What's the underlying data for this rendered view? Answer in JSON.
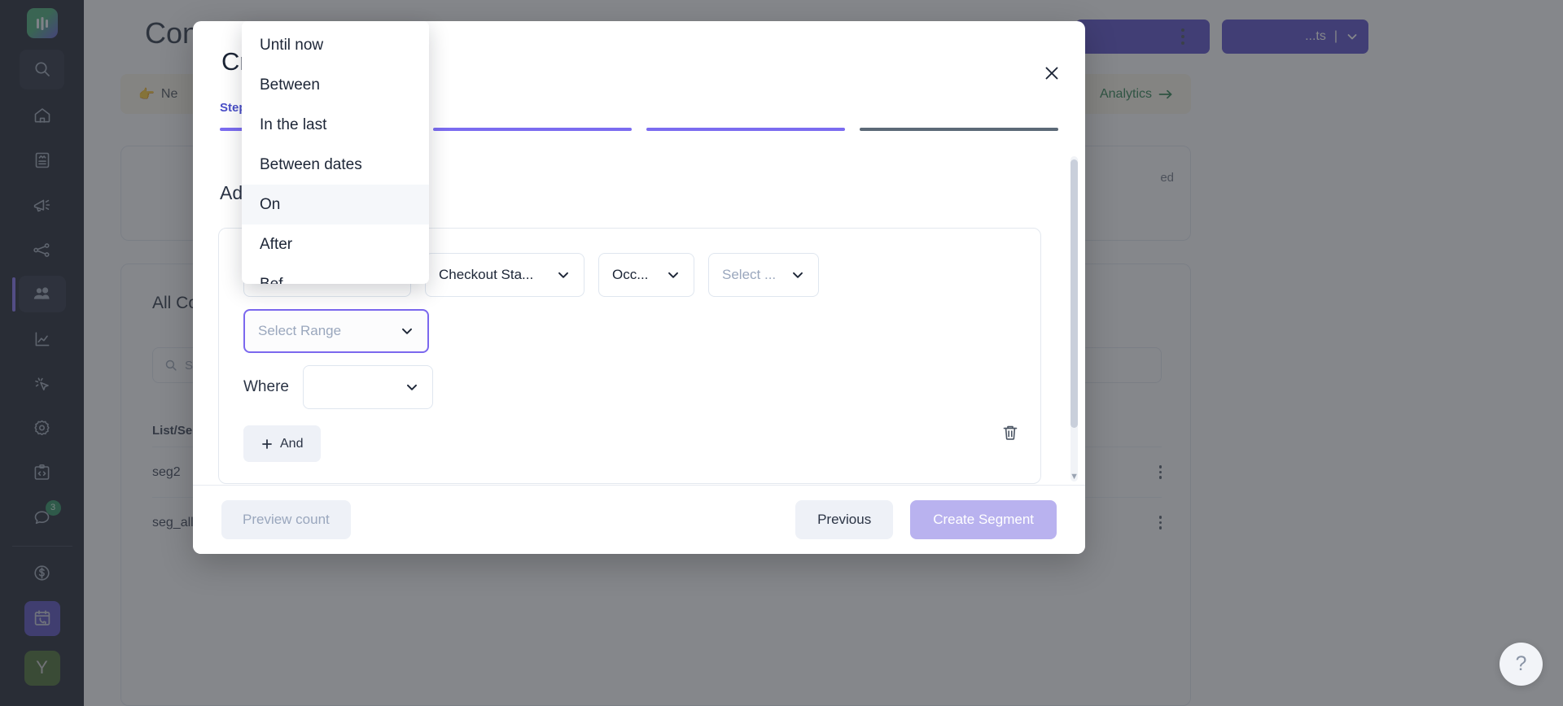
{
  "sidebar": {
    "logo_icon": "app-logo-icon",
    "search_icon": "search-icon",
    "items": [
      {
        "icon": "home-icon",
        "name": "home"
      },
      {
        "icon": "document-icon",
        "name": "campaigns-document"
      },
      {
        "icon": "megaphone-icon",
        "name": "broadcasts"
      },
      {
        "icon": "share-nodes-icon",
        "name": "journeys"
      },
      {
        "icon": "people-icon",
        "name": "contacts",
        "active": true
      },
      {
        "icon": "chart-line-icon",
        "name": "analytics"
      },
      {
        "icon": "cursor-click-icon",
        "name": "events"
      },
      {
        "icon": "gear-icon",
        "name": "settings"
      },
      {
        "icon": "code-clipboard-icon",
        "name": "developers"
      },
      {
        "icon": "chat-icon",
        "name": "support",
        "badge": "3"
      }
    ],
    "billing_icon": "dollar-circle-icon",
    "calendar_phone_icon": "calendar-phone-icon",
    "avatar_initial": "Y"
  },
  "page": {
    "title": "Contacts",
    "header_split_label": "...ts",
    "banner_text": "Ne",
    "banner_link": "Analytics",
    "card_ghost_text": "ed",
    "list_card_title": "All Con",
    "search_placeholder": "Se",
    "table_header": "List/Se",
    "rows": [
      {
        "name": "seg2"
      },
      {
        "name": "seg_all"
      }
    ]
  },
  "modal": {
    "title": "Create Segment",
    "title_visible": "Cr",
    "close_icon": "close-icon",
    "step_label": "Step",
    "steps": [
      {
        "state": "done"
      },
      {
        "state": "done"
      },
      {
        "state": "done"
      },
      {
        "state": "todo"
      }
    ],
    "section_title": "Add",
    "section_title_full": "Add Conditions",
    "rule": {
      "field_1_value": "Checkout Sta...",
      "field_2_value": "Occ...",
      "field_3_placeholder": "Select ...",
      "range_placeholder": "Select Range",
      "where_label": "Where",
      "where_value": "",
      "and_button_label": "And",
      "and_icon": "plus-icon",
      "delete_icon": "trash-icon"
    },
    "footer": {
      "preview_label": "Preview count",
      "previous_label": "Previous",
      "create_label": "Create Segment"
    }
  },
  "dropdown": {
    "name": "range-type-dropdown",
    "items": [
      {
        "label": "Until now",
        "highlighted": false
      },
      {
        "label": "Between",
        "highlighted": false
      },
      {
        "label": "In the last",
        "highlighted": false
      },
      {
        "label": "Between dates",
        "highlighted": false
      },
      {
        "label": "On",
        "highlighted": true
      },
      {
        "label": "After",
        "highlighted": false
      },
      {
        "label": "Bef",
        "highlighted": false
      }
    ]
  },
  "help": {
    "icon": "question-mark-icon",
    "label": "?"
  },
  "colors": {
    "accent_purple": "#7b68ee",
    "sidebar_bg": "#0f1320",
    "primary_button": "#4d3fc4",
    "badge_green": "#1f8a54",
    "avatar_green": "#3c6321"
  }
}
